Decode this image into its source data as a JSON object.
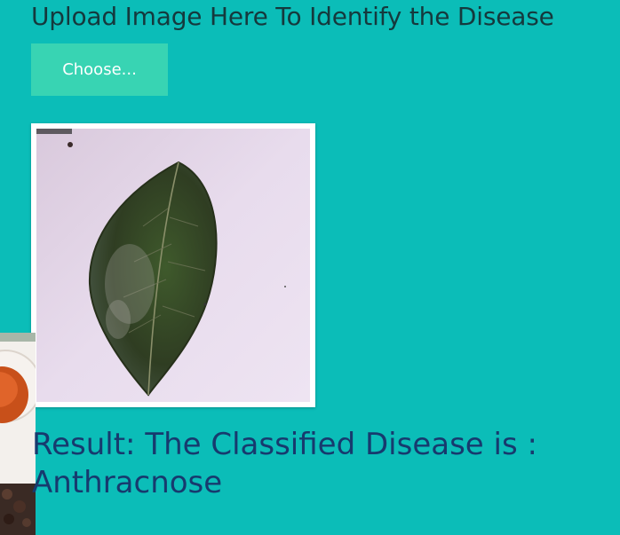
{
  "upload": {
    "heading": "Upload Image Here To Identify the Disease",
    "choose_label": "Choose..."
  },
  "preview": {
    "icon": "leaf-photo",
    "leaf_color": "#3c4a2a",
    "background_color": "#e6d9ea"
  },
  "result": {
    "text": "Result: The Classified Disease is : Anthracnose"
  },
  "colors": {
    "page_background": "#0bbdb8",
    "button": "#38d4b3",
    "result_text": "#173a6e"
  }
}
